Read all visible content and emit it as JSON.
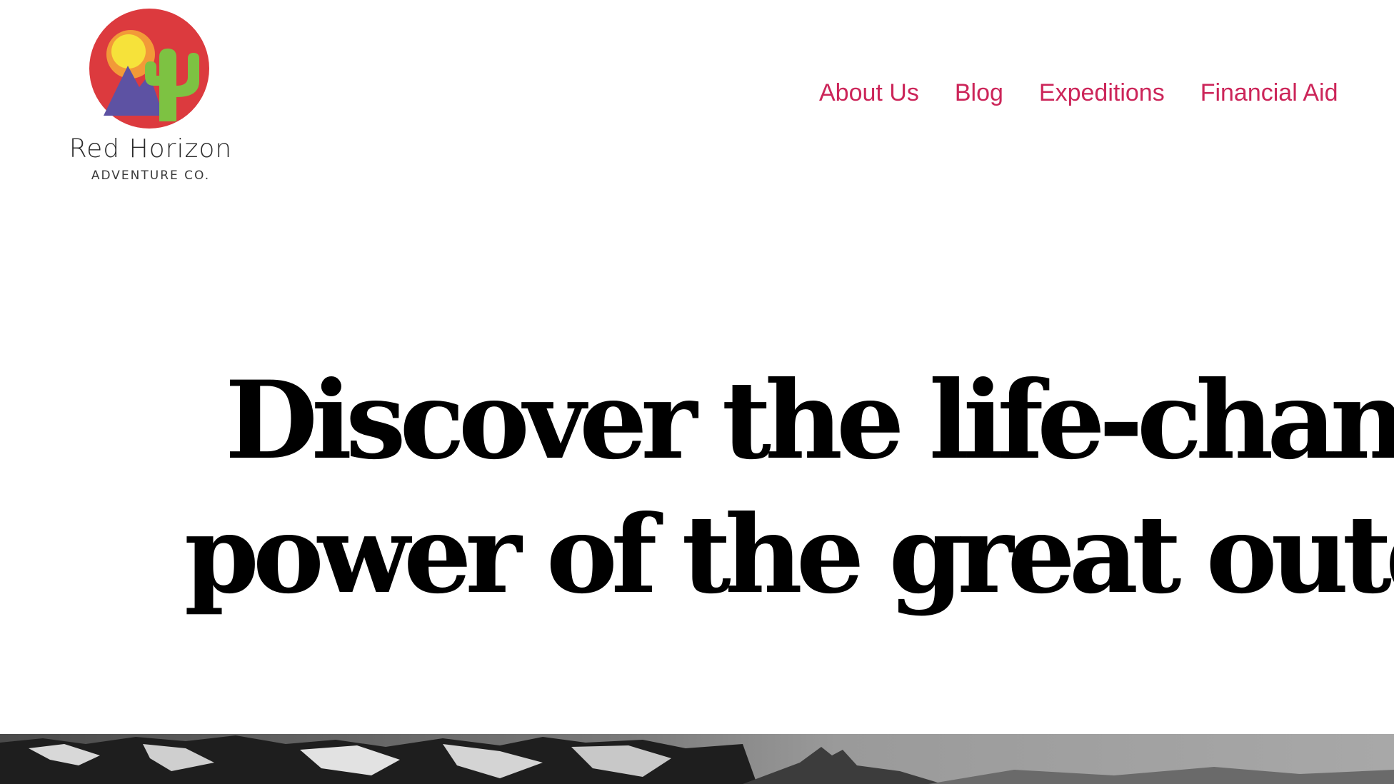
{
  "brand": {
    "name": "Red Horizon",
    "tagline": "ADVENTURE CO.",
    "logo_icon": "sun-mountain-cactus-icon",
    "colors": {
      "circle": "#dc3a3e",
      "sun": "#f6e23a",
      "sun_ring": "#f29a38",
      "mountain": "#5d52a3",
      "cactus": "#7dc242"
    }
  },
  "nav": {
    "items": [
      {
        "label": "About Us"
      },
      {
        "label": "Blog"
      },
      {
        "label": "Expeditions"
      },
      {
        "label": "Financial Aid"
      }
    ],
    "color": "#cc2559"
  },
  "hero": {
    "title_line_1": "Discover the life-changing",
    "title_line_2": "power of the great outdoors",
    "image": "snowy-mountains-photo"
  }
}
